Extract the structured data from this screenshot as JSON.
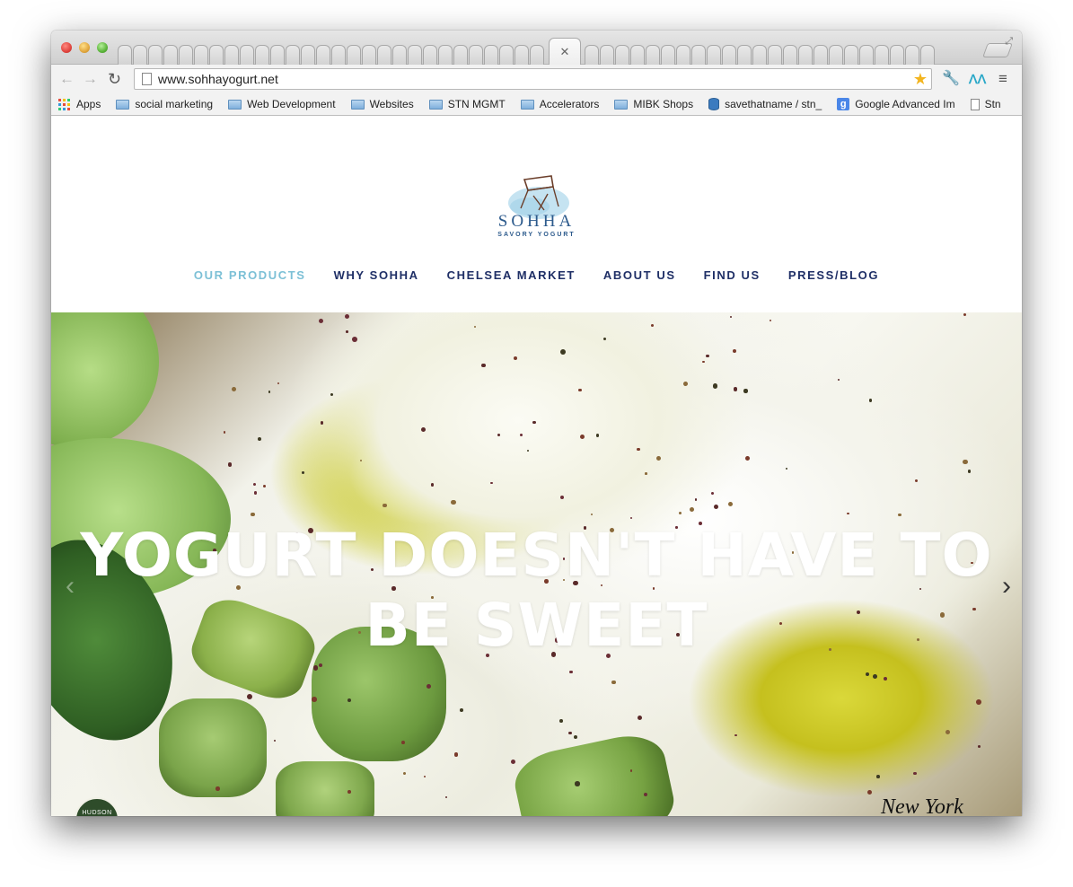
{
  "browser": {
    "url": "www.sohhayogurt.net",
    "bookmarks": [
      {
        "label": "Apps",
        "icon": "apps-icon"
      },
      {
        "label": "social marketing",
        "icon": "folder-icon"
      },
      {
        "label": "Web Development",
        "icon": "folder-icon"
      },
      {
        "label": "Websites",
        "icon": "folder-icon"
      },
      {
        "label": "STN MGMT",
        "icon": "folder-icon"
      },
      {
        "label": "Accelerators",
        "icon": "folder-icon"
      },
      {
        "label": "MIBK Shops",
        "icon": "folder-icon"
      },
      {
        "label": "savethatname / stn_",
        "icon": "db-icon"
      },
      {
        "label": "Google Advanced Im",
        "icon": "google-icon"
      },
      {
        "label": "Stn",
        "icon": "doc-icon"
      }
    ]
  },
  "site": {
    "logo_name": "SOHHA",
    "logo_tagline": "SAVORY YOGURT",
    "nav": [
      {
        "label": "OUR PRODUCTS",
        "active": true
      },
      {
        "label": "WHY SOHHA",
        "active": false
      },
      {
        "label": "CHELSEA MARKET",
        "active": false
      },
      {
        "label": "ABOUT US",
        "active": false
      },
      {
        "label": "FIND US",
        "active": false
      },
      {
        "label": "PRESS/BLOG",
        "active": false
      }
    ],
    "hero": {
      "line1": "YOGURT DOESN'T HAVE TO",
      "line2": "BE SWEET",
      "badge_text": "HUDSON",
      "press_logo_text": "New York"
    },
    "colors": {
      "nav_text": "#1f2f66",
      "nav_active": "#7cc0d6",
      "brand_blue": "#2c5a8c"
    }
  }
}
